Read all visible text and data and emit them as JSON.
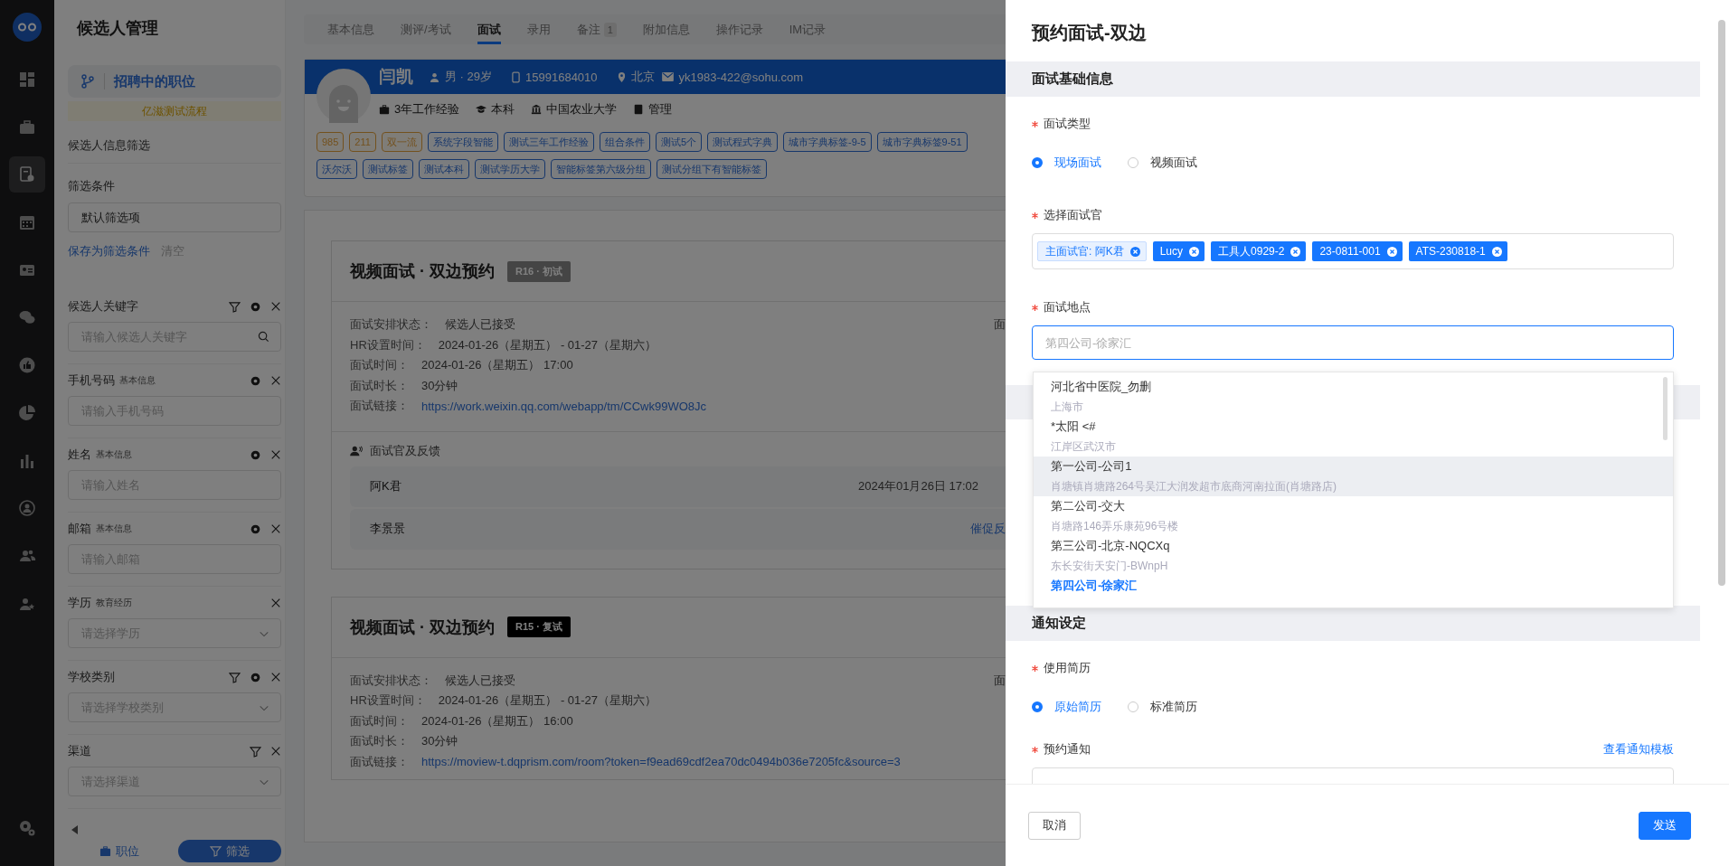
{
  "nav_rail": [
    {
      "selected": false
    },
    {
      "selected": false
    },
    {
      "selected": true
    },
    {
      "selected": false
    },
    {
      "selected": false
    },
    {
      "selected": false
    },
    {
      "selected": false
    },
    {
      "selected": false
    },
    {
      "selected": false
    },
    {
      "selected": false
    },
    {
      "selected": false
    },
    {
      "selected": false
    }
  ],
  "left_panel": {
    "title": "候选人管理",
    "pipeline": "招聘中的职位",
    "process": "亿滋测试流程",
    "filter_heading": "候选人信息筛选",
    "conditions_label": "筛选条件",
    "conditions_value": "默认筛选项",
    "save_link": "保存为筛选条件",
    "clear_link": "清空",
    "filters": [
      {
        "label": "候选人关键字",
        "placeholder": "请输入候选人关键字",
        "kind": "search",
        "tools": [
          {
            "kind": "filter"
          },
          {
            "kind": "settings"
          },
          {
            "kind": "close"
          }
        ]
      },
      {
        "label": "手机号码",
        "group": "基本信息",
        "placeholder": "请输入手机号码",
        "kind": "text",
        "tools": [
          {
            "kind": "settings"
          },
          {
            "kind": "close"
          }
        ]
      },
      {
        "label": "姓名",
        "group": "基本信息",
        "placeholder": "请输入姓名",
        "kind": "text",
        "tools": [
          {
            "kind": "settings"
          },
          {
            "kind": "close"
          }
        ]
      },
      {
        "label": "邮箱",
        "group": "基本信息",
        "placeholder": "请输入邮箱",
        "kind": "text",
        "tools": [
          {
            "kind": "settings"
          },
          {
            "kind": "close"
          }
        ]
      },
      {
        "label": "学历",
        "group": "教育经历",
        "placeholder": "请选择学历",
        "kind": "select",
        "tools": [
          {
            "kind": "close"
          }
        ]
      },
      {
        "label": "学校类别",
        "placeholder": "请选择学校类别",
        "kind": "select",
        "tools": [
          {
            "kind": "filter"
          },
          {
            "kind": "settings"
          },
          {
            "kind": "close"
          }
        ]
      },
      {
        "label": "渠道",
        "placeholder": "请选择渠道",
        "kind": "select",
        "tools": [
          {
            "kind": "filter"
          },
          {
            "kind": "close"
          }
        ]
      }
    ],
    "bottom_tabs": [
      {
        "label": "职位",
        "selected": false
      },
      {
        "label": "筛选",
        "selected": true
      }
    ]
  },
  "tabs": [
    {
      "label": "基本信息",
      "selected": false
    },
    {
      "label": "测评/考试",
      "selected": false
    },
    {
      "label": "面试",
      "selected": true
    },
    {
      "label": "录用",
      "selected": false
    },
    {
      "label": "备注",
      "selected": false,
      "badge": "1"
    },
    {
      "label": "附加信息",
      "selected": false
    },
    {
      "label": "操作记录",
      "selected": false
    },
    {
      "label": "IM记录",
      "selected": false
    }
  ],
  "candidate": {
    "name": "闫凯",
    "gender_age": "男 · 29岁",
    "phone": "15991684010",
    "city": "北京",
    "email": "yk1983-422@sohu.com",
    "facts": [
      {
        "kind": "experience",
        "text": "3年工作经验"
      },
      {
        "kind": "degree",
        "text": "本科"
      },
      {
        "kind": "school",
        "text": "中国农业大学"
      },
      {
        "kind": "major",
        "text": "管理"
      }
    ],
    "tags": [
      {
        "label": "985",
        "kind": "school"
      },
      {
        "label": "211",
        "kind": "school"
      },
      {
        "label": "双一流",
        "kind": "school"
      },
      {
        "label": "系统字段智能",
        "kind": "custom"
      },
      {
        "label": "测试三年工作经验",
        "kind": "custom"
      },
      {
        "label": "组合条件",
        "kind": "custom"
      },
      {
        "label": "测试5个",
        "kind": "custom"
      },
      {
        "label": "测试程式字典",
        "kind": "custom"
      },
      {
        "label": "城市字典标签-9-5",
        "kind": "custom"
      },
      {
        "label": "城市字典标签9-51",
        "kind": "custom"
      },
      {
        "label": "沃尔沃",
        "kind": "custom"
      },
      {
        "label": "测试标签",
        "kind": "custom"
      },
      {
        "label": "测试本科",
        "kind": "custom"
      },
      {
        "label": "测试学历大学",
        "kind": "custom"
      },
      {
        "label": "智能标签第六级分组",
        "kind": "custom"
      },
      {
        "label": "测试分组下有智能标签",
        "kind": "custom"
      }
    ]
  },
  "interviews": [
    {
      "title": "视频面试 · 双边预约",
      "badge": {
        "text": "R16 · 初试",
        "kind": "muted"
      },
      "side_text": "面",
      "fields": [
        {
          "label": "面试安排状态：",
          "value": "候选人已接受",
          "kind": "text"
        },
        {
          "label": "HR设置时间：",
          "value": "2024-01-26（星期五） - 01-27（星期六）",
          "kind": "text"
        },
        {
          "label": "面试时间：",
          "value": "2024-01-26（星期五） 17:00",
          "kind": "text"
        },
        {
          "label": "面试时长：",
          "value": "30分钟",
          "kind": "text"
        },
        {
          "label": "面试链接：",
          "value": "https://work.weixin.qq.com/webapp/tm/CCwk99WO8Jc",
          "kind": "link"
        }
      ],
      "feedback": {
        "title": "面试官及反馈",
        "rows": [
          {
            "name": "阿K君",
            "time": "2024年01月26日 17:02"
          },
          {
            "name": "李景景",
            "action": "催促反"
          }
        ]
      }
    },
    {
      "title": "视频面试 · 双边预约",
      "badge": {
        "text": "R15 · 复试",
        "kind": "dark"
      },
      "side_text": "面",
      "fields": [
        {
          "label": "面试安排状态：",
          "value": "候选人已接受",
          "kind": "text"
        },
        {
          "label": "HR设置时间：",
          "value": "2024-01-26（星期五） - 01-27（星期六）",
          "kind": "text"
        },
        {
          "label": "面试时间：",
          "value": "2024-01-26（星期五） 16:00",
          "kind": "text"
        },
        {
          "label": "面试时长：",
          "value": "30分钟",
          "kind": "text"
        },
        {
          "label": "面试链接：",
          "value": "https://moview-t.dqprism.com/room?token=f9ead69cdf2ea70dc0494b036e7205fc&source=3",
          "kind": "link"
        }
      ]
    }
  ],
  "drawer": {
    "title": "预约面试-双边",
    "basic_section": "面试基础信息",
    "interview_type": {
      "label": "面试类型",
      "required": true,
      "options": [
        {
          "label": "现场面试",
          "selected": true
        },
        {
          "label": "视频面试",
          "selected": false
        }
      ]
    },
    "interviewers": {
      "label": "选择面试官",
      "required": true,
      "tags": [
        {
          "label": "主面试官: 阿K君",
          "kind": "main"
        },
        {
          "label": "Lucy",
          "kind": "normal"
        },
        {
          "label": "工具人0929-2",
          "kind": "normal"
        },
        {
          "label": "23-0811-001",
          "kind": "normal"
        },
        {
          "label": "ATS-230818-1",
          "kind": "normal"
        }
      ]
    },
    "location": {
      "label": "面试地点",
      "required": true,
      "placeholder": "第四公司-徐家汇",
      "focused": true,
      "options": [
        {
          "name": "河北省中医院_勿删",
          "address": "上海市",
          "hovered": false,
          "selected": false
        },
        {
          "name": "*太阳 <#",
          "address": "江岸区武汉市",
          "hovered": false,
          "selected": false
        },
        {
          "name": "第一公司-公司1",
          "address": "肖塘镇肖塘路264号吴江大润发超市底商河南拉面(肖塘路店)",
          "hovered": true,
          "selected": false
        },
        {
          "name": "第二公司-交大",
          "address": "肖塘路146弄乐康苑96号楼",
          "hovered": false,
          "selected": false
        },
        {
          "name": "第三公司-北京-NQCXq",
          "address": "东长安街天安门-BWnpH",
          "hovered": false,
          "selected": false
        },
        {
          "name": "第四公司-徐家汇",
          "hovered": false,
          "selected": true
        }
      ]
    },
    "notice_section": "通知设定",
    "resume": {
      "label": "使用简历",
      "required": true,
      "options": [
        {
          "label": "原始简历",
          "selected": true
        },
        {
          "label": "标准简历",
          "selected": false
        }
      ]
    },
    "notice": {
      "label": "预约通知",
      "required": true,
      "link": "查看通知模板"
    },
    "buttons": [
      {
        "label": "取消",
        "kind": "default"
      },
      {
        "label": "发送",
        "kind": "primary"
      }
    ]
  }
}
